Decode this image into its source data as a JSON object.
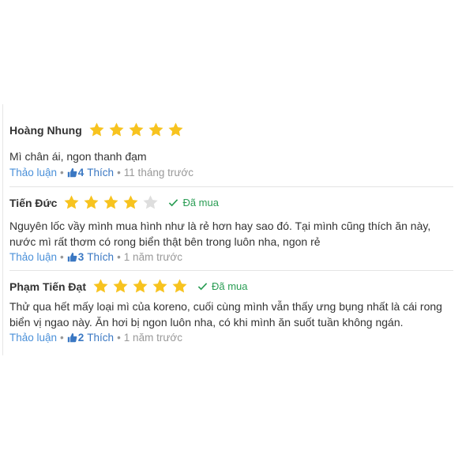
{
  "reviews": [
    {
      "author": "Hoàng Nhung",
      "rating": 5,
      "verified_label": "",
      "text": "Mì chân ái, ngon thanh đạm",
      "reply_label": "Thảo luận",
      "likes": "4",
      "like_label": "Thích",
      "time": "11 tháng trước"
    },
    {
      "author": "Tiến Đức",
      "rating": 4,
      "verified_label": "Đã mua",
      "text": "Nguyên lốc vầy mình mua hình như là rẻ hơn hay sao đó. Tại mình cũng thích ăn này, nước mì rất thơm có rong biển thật bên trong luôn nha, ngon rẻ",
      "reply_label": "Thảo luận",
      "likes": "3",
      "like_label": "Thích",
      "time": "1 năm trước"
    },
    {
      "author": "Phạm Tiến Đạt",
      "rating": 5,
      "verified_label": "Đã mua",
      "text": "Thử qua hết mấy loại mì của koreno, cuối cùng mình vẫn thấy ưng bụng nhất là cái rong biển vị ngao này. Ăn hơi bị ngon luôn nha, có khi mình ăn suốt tuần không ngán.",
      "reply_label": "Thảo luận",
      "likes": "2",
      "like_label": "Thích",
      "time": "1 năm trước"
    }
  ],
  "colors": {
    "star_filled": "#f7c31f",
    "star_empty": "#dedede",
    "verified": "#2a9d54",
    "link": "#4a90d9"
  }
}
